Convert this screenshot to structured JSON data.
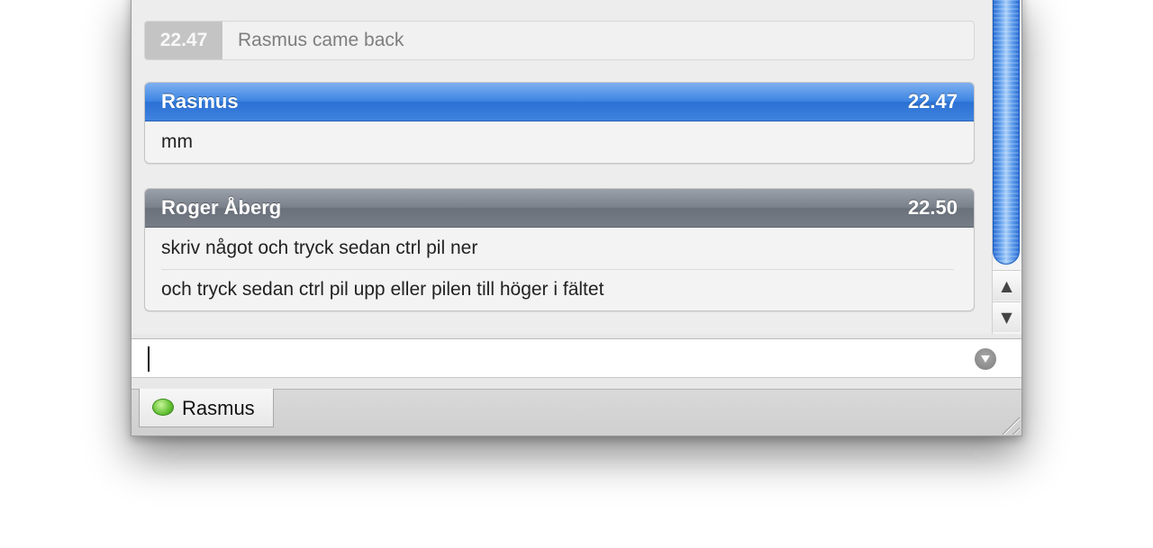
{
  "transcript": {
    "status_event": {
      "time": "22.47",
      "text": "Rasmus came back"
    },
    "messages": [
      {
        "sender": "Rasmus",
        "time": "22.47",
        "lines": [
          "mm"
        ]
      },
      {
        "sender": "Roger Åberg",
        "time": "22.50",
        "lines": [
          "skriv något och tryck sedan ctrl pil ner",
          "och tryck sedan ctrl pil upp eller pilen till höger i fältet"
        ]
      }
    ]
  },
  "input": {
    "value": ""
  },
  "icons": {
    "scroll_up": "▲",
    "scroll_down": "▼",
    "input_menu": "chevron-down-circle-icon",
    "tab_status": "green-speech-bubble-icon"
  },
  "tabs": [
    {
      "label": "Rasmus"
    }
  ],
  "colors": {
    "own_header": "#3d85e2",
    "other_header": "#767d87",
    "status_time_bg": "#c4c4c4"
  }
}
